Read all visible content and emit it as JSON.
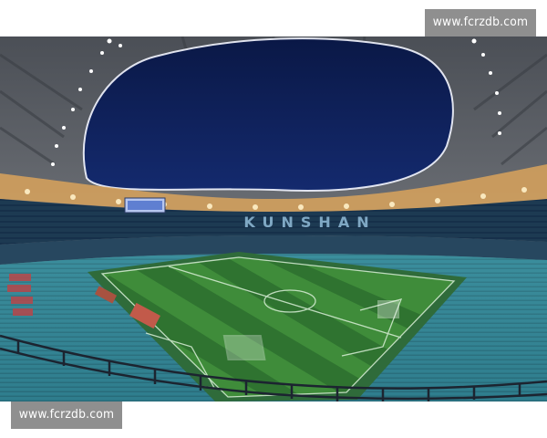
{
  "watermark": {
    "top_text": "www.fcrzdb.com",
    "bottom_text": "www.fcrzdb.com"
  },
  "photo": {
    "subject": "stadium",
    "stand_lettering": "KUNSHAN",
    "colors": {
      "sky": "#0d1d5a",
      "pitch_light": "#3f8c3a",
      "pitch_dark": "#2f7330",
      "seats": "#2f7f8f",
      "roof": "#6c6f74",
      "lights": "#ffffff"
    }
  }
}
